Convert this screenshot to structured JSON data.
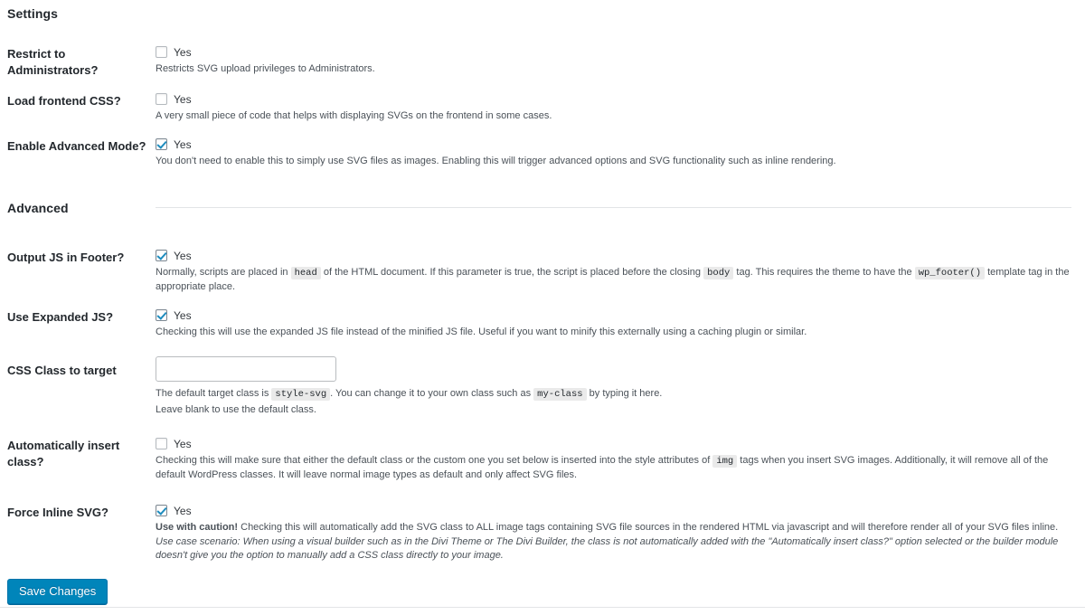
{
  "sections": {
    "settings": {
      "title": "Settings"
    },
    "advanced": {
      "title": "Advanced"
    }
  },
  "rows": {
    "restrict_admins": {
      "label": "Restrict to Administrators?",
      "checkbox_label": "Yes",
      "checked": false,
      "desc": "Restricts SVG upload privileges to Administrators."
    },
    "frontend_css": {
      "label": "Load frontend CSS?",
      "checkbox_label": "Yes",
      "checked": false,
      "desc": "A very small piece of code that helps with displaying SVGs on the frontend in some cases."
    },
    "advanced_mode": {
      "label": "Enable Advanced Mode?",
      "checkbox_label": "Yes",
      "checked": true,
      "desc": "You don't need to enable this to simply use SVG files as images. Enabling this will trigger advanced options and SVG functionality such as inline rendering."
    },
    "output_js_footer": {
      "label": "Output JS in Footer?",
      "checkbox_label": "Yes",
      "checked": true,
      "desc_part1": "Normally, scripts are placed in",
      "code1": "head",
      "desc_part2": "of the HTML document. If this parameter is true, the script is placed before the closing",
      "code2": "body",
      "desc_part3": "tag. This requires the theme to have the",
      "code3": "wp_footer()",
      "desc_part4": "template tag in the appropriate place."
    },
    "expanded_js": {
      "label": "Use Expanded JS?",
      "checkbox_label": "Yes",
      "checked": true,
      "desc": "Checking this will use the expanded JS file instead of the minified JS file. Useful if you want to minify this externally using a caching plugin or similar."
    },
    "css_class": {
      "label": "CSS Class to target",
      "value": "",
      "placeholder": "",
      "desc_part1": "The default target class is",
      "code1": "style-svg",
      "desc_part2": ". You can change it to your own class such as",
      "code2": "my-class",
      "desc_part3": "by typing it here.",
      "desc_line2": "Leave blank to use the default class."
    },
    "auto_insert_class": {
      "label": "Automatically insert class?",
      "checkbox_label": "Yes",
      "checked": false,
      "desc_part1": "Checking this will make sure that either the default class or the custom one you set below is inserted into the style attributes of",
      "code1": "img",
      "desc_part2": "tags when you insert SVG images. Additionally, it will remove all of the default WordPress classes. It will leave normal image types as default and only affect SVG files."
    },
    "force_inline": {
      "label": "Force Inline SVG?",
      "checkbox_label": "Yes",
      "checked": true,
      "desc_bold": "Use with caution!",
      "desc_rest": " Checking this will automatically add the SVG class to ALL image tags containing SVG file sources in the rendered HTML via javascript and will therefore render all of your SVG files inline.",
      "desc_italic": "Use case scenario: When using a visual builder such as in the Divi Theme or The Divi Builder, the class is not automatically added with the \"Automatically insert class?\" option selected or the builder module doesn't give you the option to manually add a CSS class directly to your image."
    }
  },
  "submit": {
    "label": "Save Changes"
  },
  "colors": {
    "accent": "#0085ba",
    "checkbox_check": "#1e8cbe",
    "text": "#23282d",
    "muted_text": "#4a5158",
    "rule": "#e2e4e7"
  }
}
